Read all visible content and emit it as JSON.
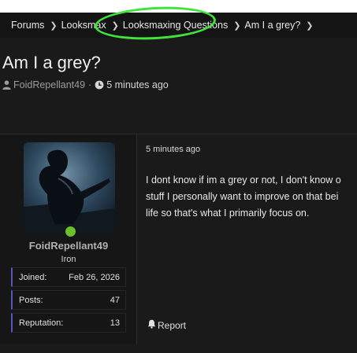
{
  "breadcrumb": {
    "items": [
      "Forums",
      "Looksmax",
      "Looksmaxing Questions",
      "Am I a grey?"
    ]
  },
  "thread": {
    "title": "Am I a grey?",
    "author": "FoidRepellant49",
    "time": "5 minutes ago"
  },
  "post": {
    "user": {
      "name": "FoidRepellant49",
      "rank": "Iron",
      "online": true,
      "stats": [
        {
          "label": "Joined:",
          "value": "Feb 26, 2026"
        },
        {
          "label": "Posts:",
          "value": "47"
        },
        {
          "label": "Reputation:",
          "value": "13"
        }
      ]
    },
    "time": "5 minutes ago",
    "body_lines": [
      "I dont know if im a grey or not, I don't know o",
      "stuff I personally want to improve on that bei",
      "life so that's what I primarily focus on."
    ],
    "report_label": "Report"
  },
  "colors": {
    "highlight": "#3ee43a",
    "online": "#6bbf2f",
    "stat_accent": "#5a55b8"
  },
  "icons": [
    "chevron-right-icon",
    "user-icon",
    "clock-icon",
    "bell-icon"
  ]
}
